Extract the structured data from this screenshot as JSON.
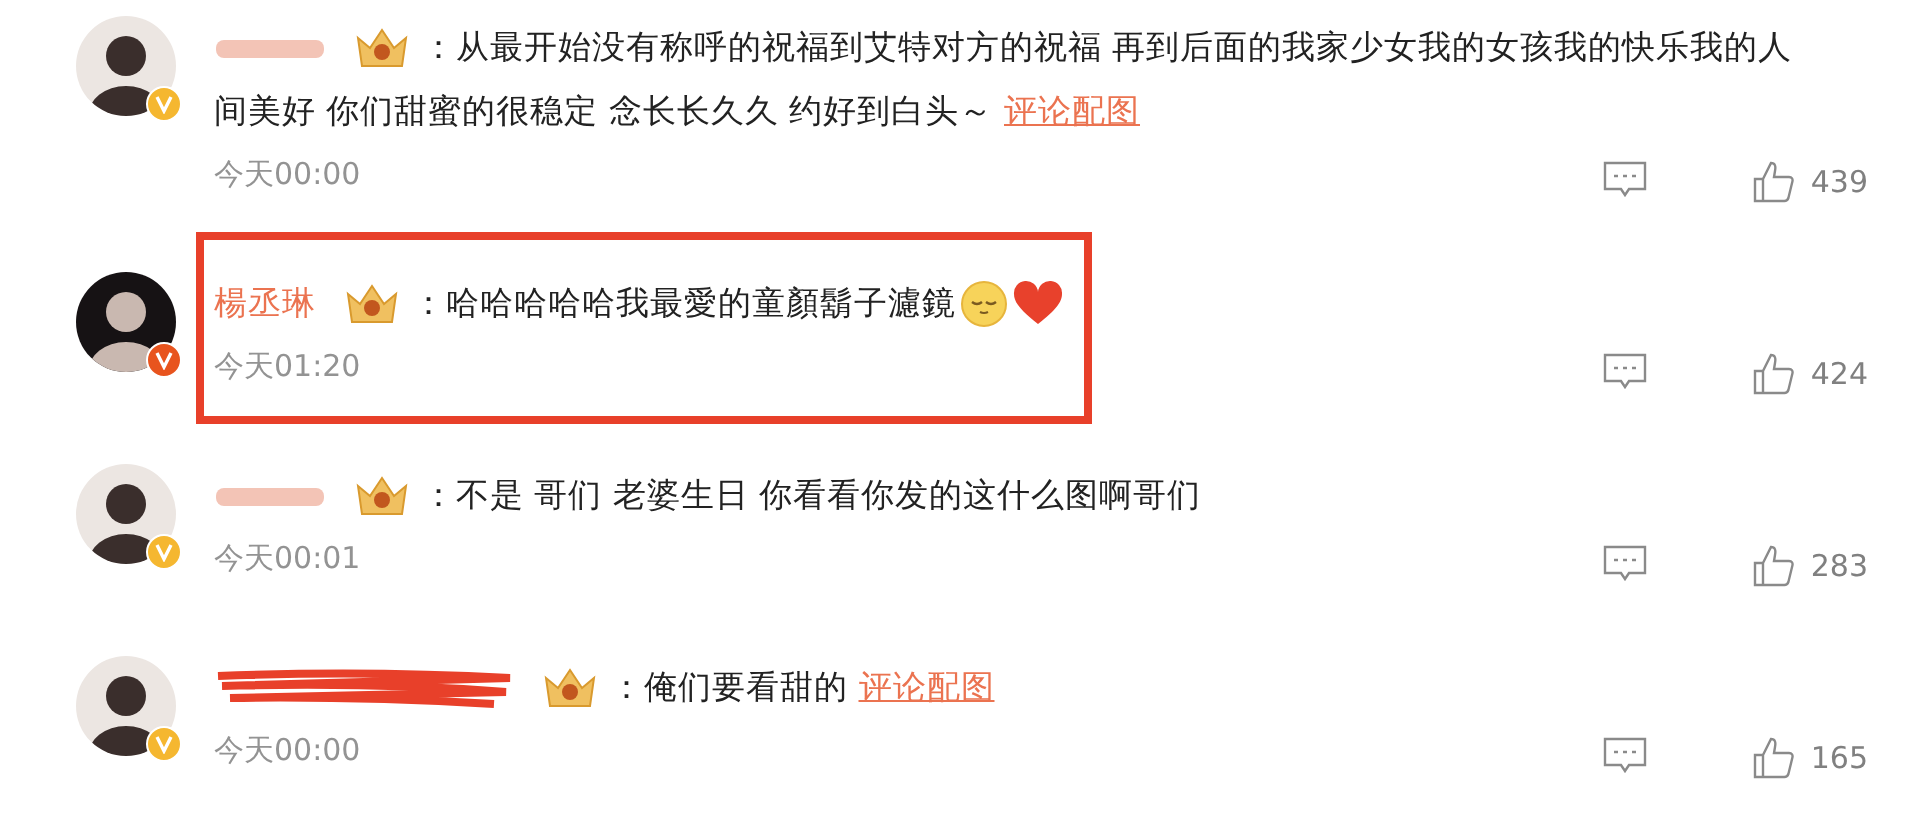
{
  "comments": [
    {
      "name_mask": {
        "kind": "blurred"
      },
      "avatar": {
        "kind": "light"
      },
      "verified": {
        "color": "#f5b730"
      },
      "separator": "：",
      "text_lines": [
        "从最开始没有称呼的祝福到艾特对方的祝福 再到后面的我家少女我的女孩我的快乐我的人",
        "间美好 你们甜蜜的很稳定 念长长久久 约好到白头～"
      ],
      "link": "评论配图",
      "highlighted": false,
      "time": "今天00:00",
      "likes": "439"
    },
    {
      "name": "楊丞琳",
      "avatar": {
        "kind": "dark"
      },
      "verified": {
        "color": "#e8541e"
      },
      "separator": "：",
      "text_lines": [
        "哈哈哈哈哈我最愛的童顏鬍子濾鏡"
      ],
      "emojis": [
        {
          "kind": "smile"
        },
        {
          "kind": "heart"
        }
      ],
      "highlighted": true,
      "time": "今天01:20",
      "likes": "424"
    },
    {
      "name_mask": {
        "kind": "blurred"
      },
      "avatar": {
        "kind": "light"
      },
      "verified": {
        "color": "#f5b730"
      },
      "separator": "：",
      "text_lines": [
        "不是 哥们 老婆生日 你看看你发的这什么图啊哥们"
      ],
      "highlighted": false,
      "time": "今天00:01",
      "likes": "283"
    },
    {
      "name_mask": {
        "kind": "scribbled"
      },
      "avatar": {
        "kind": "light"
      },
      "verified": {
        "color": "#f5b730"
      },
      "separator": "：",
      "text_lines": [
        "俺们要看甜的"
      ],
      "link": "评论配图",
      "highlighted": false,
      "time": "今天00:00",
      "likes": "165"
    }
  ]
}
